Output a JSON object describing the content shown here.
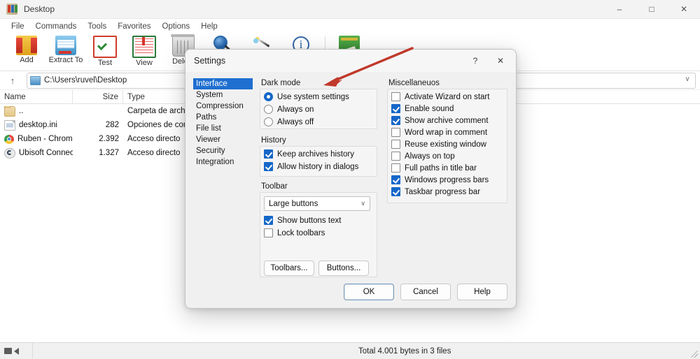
{
  "window": {
    "title": "Desktop",
    "icon": "winrar-books-icon",
    "controls": {
      "minimize": "–",
      "maximize": "□",
      "close": "✕"
    }
  },
  "menubar": {
    "items": [
      "File",
      "Commands",
      "Tools",
      "Favorites",
      "Options",
      "Help"
    ]
  },
  "toolbar": {
    "buttons": [
      {
        "label": "Add",
        "icon": "add-archive-icon"
      },
      {
        "label": "Extract To",
        "icon": "extract-folder-icon"
      },
      {
        "label": "Test",
        "icon": "test-clipboard-icon"
      },
      {
        "label": "View",
        "icon": "view-book-icon"
      },
      {
        "label": "Delete",
        "icon": "delete-trash-icon"
      },
      {
        "label": "",
        "icon": "find-magnifier-icon"
      },
      {
        "label": "",
        "icon": "wizard-wand-icon"
      },
      {
        "label": "",
        "icon": "info-circle-icon"
      },
      {
        "label": "",
        "icon": "repair-green-icon"
      }
    ]
  },
  "address": {
    "up_label": "↑",
    "path": "C:\\Users\\ruvel\\Desktop",
    "chevron": "∨"
  },
  "filelist": {
    "columns": [
      "Name",
      "Size",
      "Type"
    ],
    "rows": [
      {
        "name": "..",
        "size": "",
        "type": "Carpeta de archiv",
        "icon": "folder-icon"
      },
      {
        "name": "desktop.ini",
        "size": "282",
        "type": "Opciones de confi",
        "icon": "ini-file-icon"
      },
      {
        "name": "Ruben - Chrome....",
        "size": "2.392",
        "type": "Acceso directo",
        "icon": "chrome-shortcut-icon"
      },
      {
        "name": "Ubisoft Connect.l...",
        "size": "1.327",
        "type": "Acceso directo",
        "icon": "ubisoft-shortcut-icon"
      }
    ]
  },
  "statusbar": {
    "total": "Total 4.001 bytes in 3 files"
  },
  "dialog": {
    "title": "Settings",
    "help_glyph": "?",
    "close_glyph": "✕",
    "nav": {
      "items": [
        "Interface",
        "System",
        "Compression",
        "Paths",
        "File list",
        "Viewer",
        "Security",
        "Integration"
      ],
      "selected": "Interface"
    },
    "dark_mode": {
      "label": "Dark mode",
      "options": [
        {
          "label": "Use system settings",
          "selected": true
        },
        {
          "label": "Always on",
          "selected": false
        },
        {
          "label": "Always off",
          "selected": false
        }
      ]
    },
    "history": {
      "label": "History",
      "options": [
        {
          "label": "Keep archives history",
          "checked": true
        },
        {
          "label": "Allow history in dialogs",
          "checked": true
        }
      ]
    },
    "toolbar_group": {
      "label": "Toolbar",
      "combo_value": "Large buttons",
      "combo_arrow": "∨",
      "options": [
        {
          "label": "Show buttons text",
          "checked": true
        },
        {
          "label": "Lock toolbars",
          "checked": false
        }
      ],
      "buttons": [
        {
          "label": "Toolbars..."
        },
        {
          "label": "Buttons..."
        }
      ]
    },
    "miscellaneous": {
      "label": "Miscellaneuos",
      "options": [
        {
          "label": "Activate Wizard on start",
          "checked": false
        },
        {
          "label": "Enable sound",
          "checked": true
        },
        {
          "label": "Show archive comment",
          "checked": true
        },
        {
          "label": "Word wrap in comment",
          "checked": false
        },
        {
          "label": "Reuse existing window",
          "checked": false
        },
        {
          "label": "Always on top",
          "checked": false
        },
        {
          "label": "Full paths in title bar",
          "checked": false
        },
        {
          "label": "Windows progress bars",
          "checked": true
        },
        {
          "label": "Taskbar progress bar",
          "checked": true
        }
      ]
    },
    "footer_buttons": [
      {
        "label": "OK",
        "default": true
      },
      {
        "label": "Cancel",
        "default": false
      },
      {
        "label": "Help",
        "default": false
      }
    ]
  },
  "annotation": {
    "type": "red-arrow",
    "color": "#c0392b",
    "points_to": "Dark mode"
  },
  "colors": {
    "accent": "#1f6fd0",
    "checkbox_on": "#1567c8",
    "annotation_red": "#c0392b",
    "dialog_bg": "#f0f0f0"
  }
}
